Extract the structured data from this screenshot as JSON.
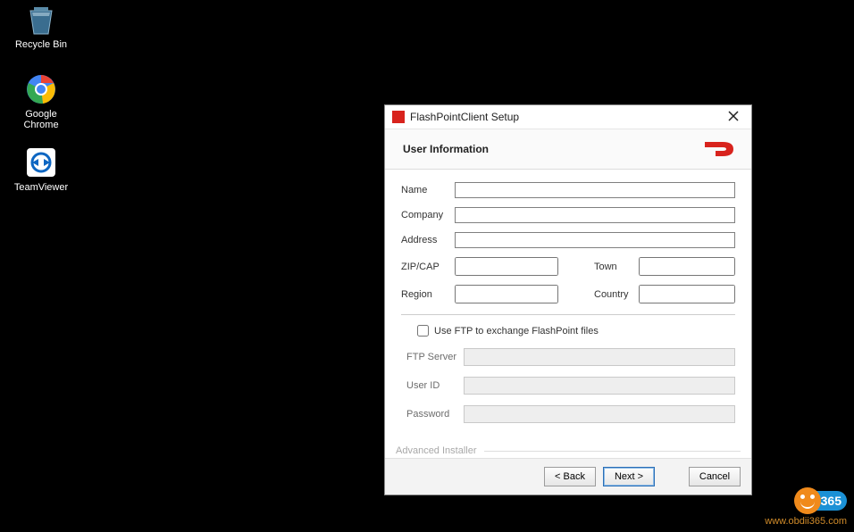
{
  "desktop": {
    "icons": [
      {
        "label": "Recycle Bin"
      },
      {
        "label": "Google Chrome"
      },
      {
        "label": "TeamViewer"
      }
    ]
  },
  "dialog": {
    "title": "FlashPointClient Setup",
    "header": "User Information",
    "fields": {
      "name_label": "Name",
      "company_label": "Company",
      "address_label": "Address",
      "zip_label": "ZIP/CAP",
      "region_label": "Region",
      "town_label": "Town",
      "country_label": "Country",
      "name_value": "",
      "company_value": "",
      "address_value": "",
      "zip_value": "",
      "region_value": "",
      "town_value": "",
      "country_value": ""
    },
    "ftp": {
      "checkbox_label": "Use FTP to exchange FlashPoint files",
      "server_label": "FTP Server",
      "userid_label": "User ID",
      "password_label": "Password",
      "server_value": "",
      "userid_value": "",
      "password_value": ""
    },
    "advanced_installer": "Advanced Installer",
    "buttons": {
      "back": "< Back",
      "next": "Next >",
      "cancel": "Cancel"
    }
  },
  "watermark": {
    "badge_number": "365",
    "url": "www.obdii365.com"
  }
}
